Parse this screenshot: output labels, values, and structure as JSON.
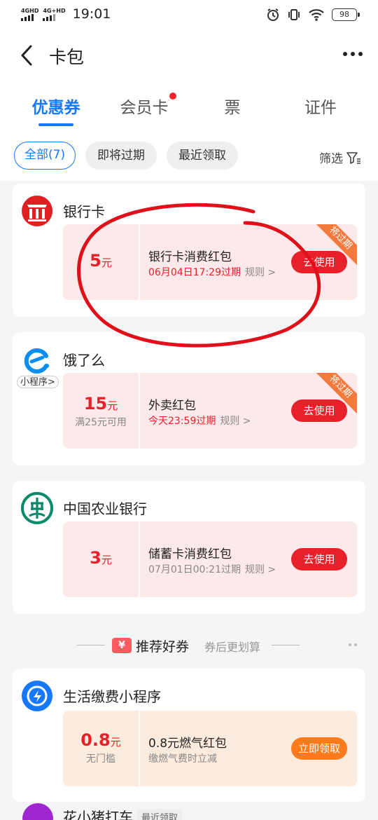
{
  "status_bar": {
    "sim1": "4GHD",
    "sim2": "4G+HD",
    "time": "19:01",
    "battery": "98"
  },
  "nav": {
    "title": "卡包",
    "back_icon": "chevron-left-icon",
    "more_icon": "more-dots-icon"
  },
  "tabs": [
    {
      "label": "优惠券",
      "active": true
    },
    {
      "label": "会员卡",
      "active": false,
      "dot": true
    },
    {
      "label": "票",
      "active": false
    },
    {
      "label": "证件",
      "active": false
    }
  ],
  "filters": {
    "chips": [
      {
        "label": "全部(7)",
        "active": true
      },
      {
        "label": "即将过期",
        "active": false
      },
      {
        "label": "最近领取",
        "active": false
      }
    ],
    "filter_label": "筛选"
  },
  "cards": [
    {
      "merchant": "银行卡",
      "coupon": {
        "amount": "5",
        "unit": "元",
        "condition": "",
        "title": "银行卡消费红包",
        "expire": "06月04日17:29过期",
        "rule": "规则 >",
        "button": "去使用",
        "ribbon": "将过期"
      }
    },
    {
      "merchant": "饿了么",
      "mini_tag": "小程序>",
      "coupon": {
        "amount": "15",
        "unit": "元",
        "condition": "满25元可用",
        "title": "外卖红包",
        "expire": "今天23:59过期",
        "rule": "规则 >",
        "button": "去使用",
        "ribbon": "将过期"
      }
    },
    {
      "merchant": "中国农业银行",
      "coupon": {
        "amount": "3",
        "unit": "元",
        "condition": "",
        "title": "储蓄卡消费红包",
        "expire": "07月01日00:21过期",
        "rule": "规则 >",
        "button": "去使用"
      }
    }
  ],
  "recommend": {
    "icon": "¥",
    "title": "推荐好券",
    "subtitle": "券后更划算"
  },
  "rec_cards": [
    {
      "merchant": "生活缴费小程序",
      "coupon": {
        "amount": "0.8",
        "unit": "元",
        "condition": "无门槛",
        "title": "0.8元燃气红包",
        "desc": "缴燃气费时立减",
        "button": "立即领取"
      }
    }
  ],
  "partial_card": {
    "merchant": "花小猪打车",
    "tag": "最近领取"
  },
  "colors": {
    "accent": "#1677ff",
    "red": "#e8202a",
    "annotation": "#e0101a"
  }
}
